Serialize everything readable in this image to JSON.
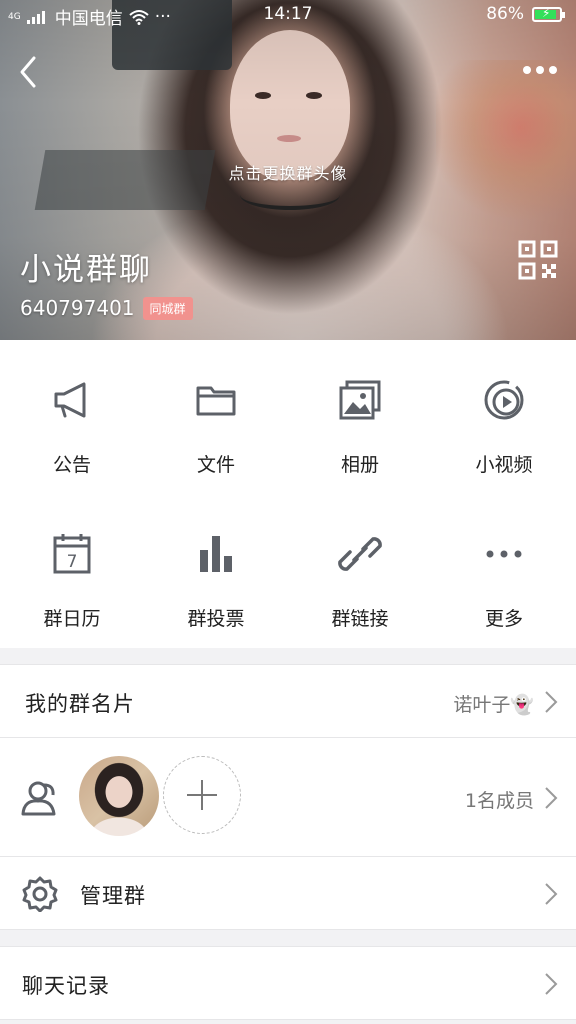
{
  "status_bar": {
    "network": "4G",
    "carrier": "中国电信",
    "extra": "···",
    "time": "14:17",
    "battery": "86%",
    "battery_level": 0.86
  },
  "header": {
    "change_avatar_hint": "点击更换群头像",
    "group_name": "小说群聊",
    "group_id": "640797401",
    "badge": "同城群"
  },
  "features": [
    {
      "label": "公告",
      "icon": "megaphone-icon"
    },
    {
      "label": "文件",
      "icon": "folder-icon"
    },
    {
      "label": "相册",
      "icon": "photo-album-icon"
    },
    {
      "label": "小视频",
      "icon": "video-play-icon"
    },
    {
      "label": "群日历",
      "icon": "calendar-icon"
    },
    {
      "label": "群投票",
      "icon": "bar-chart-icon"
    },
    {
      "label": "群链接",
      "icon": "link-icon"
    },
    {
      "label": "更多",
      "icon": "more-dots-icon"
    }
  ],
  "calendar_day": "7",
  "rows": {
    "card": {
      "label": "我的群名片",
      "value": "诺叶子👻"
    },
    "members": {
      "count_text": "1名成员"
    },
    "manage": {
      "label": "管理群"
    },
    "history": {
      "label": "聊天记录"
    }
  },
  "colors": {
    "icon_gray": "#5d6168",
    "badge": "#f1928e",
    "battery": "#33e05a"
  }
}
